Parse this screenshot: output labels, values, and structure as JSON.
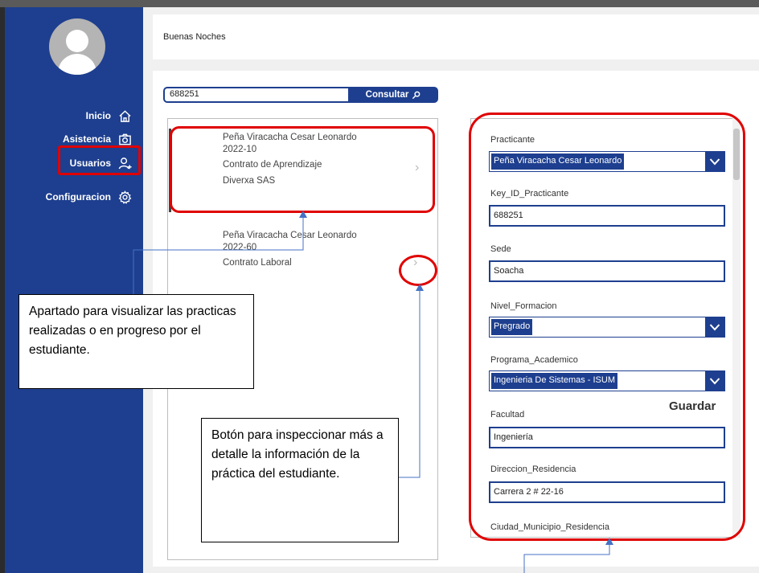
{
  "sidebar": {
    "nav": [
      {
        "label": "Inicio",
        "icon": "home-icon"
      },
      {
        "label": "Asistencia",
        "icon": "camera-icon"
      },
      {
        "label": "Usuarios",
        "icon": "add-user-icon"
      },
      {
        "label": "Configuracion",
        "icon": "settings-gear-icon"
      }
    ]
  },
  "header": {
    "greeting": "Buenas Noches"
  },
  "search": {
    "value": "688251",
    "button_label": "Consultar"
  },
  "records": [
    {
      "name": "Peña Viracacha Cesar Leonardo",
      "period": "2022-10",
      "contract": "Contrato de Aprendizaje",
      "company": "Diverxa SAS"
    },
    {
      "name": "Peña Viracacha Cesar Leonardo",
      "period": "2022-60",
      "contract": "Contrato Laboral"
    }
  ],
  "form": {
    "practicante": {
      "label": "Practicante",
      "value": "Peña Viracacha Cesar Leonardo"
    },
    "key_id": {
      "label": "Key_ID_Practicante",
      "value": "688251"
    },
    "sede": {
      "label": "Sede",
      "value": "Soacha"
    },
    "nivel": {
      "label": "Nivel_Formacion",
      "value": "Pregrado"
    },
    "programa": {
      "label": "Programa_Academico",
      "value": "Ingenieria De Sistemas - ISUM"
    },
    "facultad": {
      "label": "Facultad",
      "value": "Ingeniería"
    },
    "direccion": {
      "label": "Direccion_Residencia",
      "value": "Carrera 2 # 22-16"
    },
    "ciudad": {
      "label": "Ciudad_Municipio_Residencia"
    },
    "save_label": "Guardar"
  },
  "annotations": {
    "list_note": "Apartado para visualizar las practicas realizadas o en progreso por el estudiante.",
    "button_note": "Botón para inspeccionar más a detalle la información de la práctica del estudiante."
  },
  "colors": {
    "sidebar": "#1e3f8f",
    "highlight": "#e00000",
    "accent": "#1e3f8f"
  }
}
